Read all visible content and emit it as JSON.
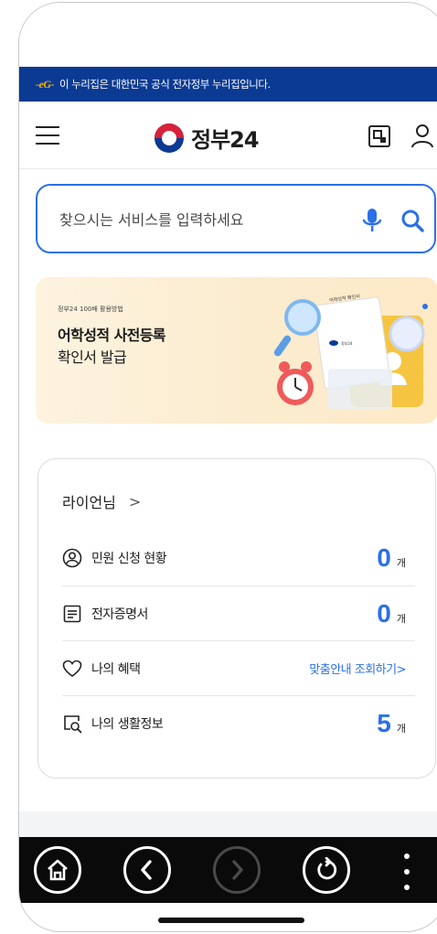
{
  "gov_banner": {
    "flag_text": "-eG-",
    "text": "이 누리집은 대한민국 공식 전자정부 누리집입니다."
  },
  "header": {
    "logo_text": "정부24",
    "menu_icon": "hamburger-icon",
    "qr_icon": "qr-code-icon",
    "user_icon": "user-icon"
  },
  "search": {
    "placeholder": "찾으시는 서비스를 입력하세요",
    "mic_icon": "microphone-icon",
    "search_icon": "search-icon"
  },
  "promo": {
    "small_text": "정부24 100배 활용방법",
    "title": "어학성적 사전등록",
    "subtitle": "확인서 발급",
    "doc_text": "어학성적 확인서",
    "card_text": "정부24"
  },
  "summary_card": {
    "user_name": "라이언님",
    "user_chevron": ">",
    "rows": [
      {
        "icon": "user-circle-icon",
        "label": "민원 신청 현황",
        "value": "0",
        "unit": "개"
      },
      {
        "icon": "document-list-icon",
        "label": "전자증명서",
        "value": "0",
        "unit": "개"
      },
      {
        "icon": "heart-icon",
        "label": "나의 혜택",
        "link": "맞춤안내 조회하기",
        "arrow": ">"
      },
      {
        "icon": "search-document-icon",
        "label": "나의 생활정보",
        "value": "5",
        "unit": "개"
      }
    ]
  },
  "bottom_nav": {
    "home_icon": "home-icon",
    "back_icon": "chevron-left-icon",
    "forward_icon": "chevron-right-icon",
    "refresh_icon": "refresh-icon",
    "more_icon": "more-vertical-icon"
  },
  "colors": {
    "banner_bg": "#0b3a93",
    "accent_blue": "#2b70e8",
    "logo_red": "#d9213a",
    "bottom_bar": "#0a0a0a"
  }
}
